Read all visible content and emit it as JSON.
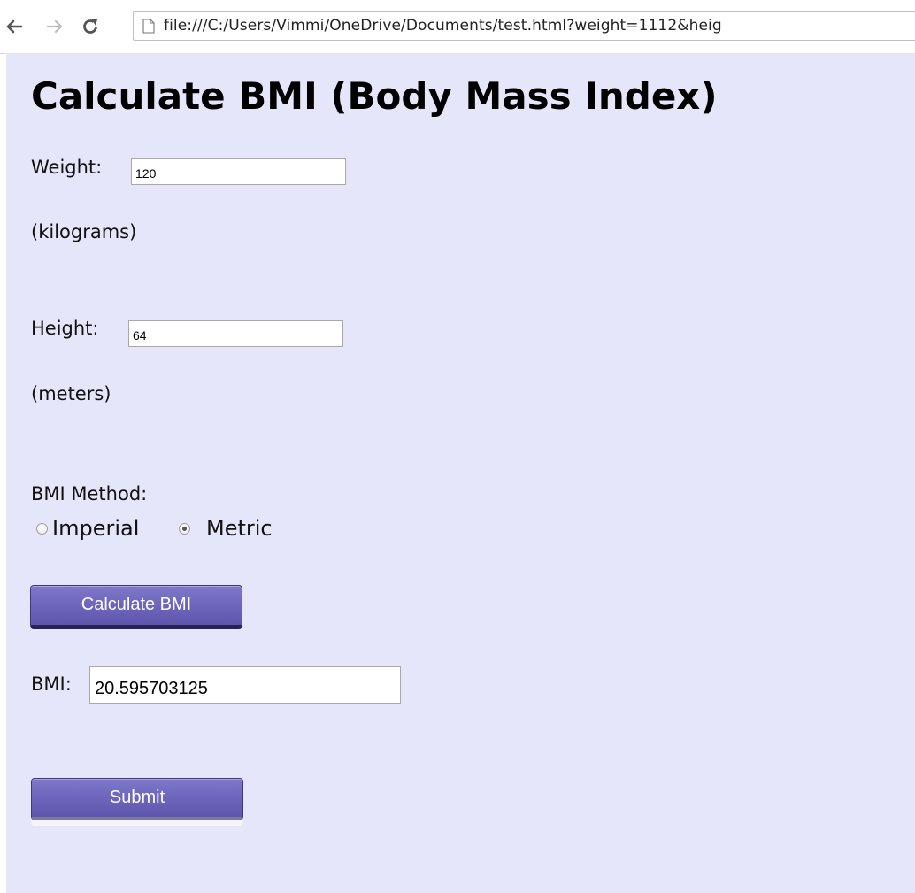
{
  "browser": {
    "url": "file:///C:/Users/Vimmi/OneDrive/Documents/test.html?weight=1112&heig"
  },
  "form": {
    "title": "Calculate BMI (Body Mass Index)",
    "weight_label": "Weight:",
    "weight_value": "120",
    "weight_unit": "(kilograms)",
    "height_label": "Height:",
    "height_value": "64",
    "height_unit": "(meters)",
    "method_label": "BMI Method:",
    "method_options": [
      {
        "label": "Imperial",
        "checked": false
      },
      {
        "label": "Metric",
        "checked": true
      }
    ],
    "calculate_label": "Calculate BMI",
    "bmi_label": "BMI:",
    "bmi_value": "20.595703125",
    "submit_label": "Submit"
  },
  "colors": {
    "page_background": "#e6e6fa",
    "button": "#6e67bd"
  }
}
